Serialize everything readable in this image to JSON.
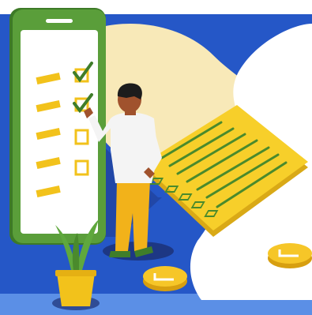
{
  "illustration": {
    "subject": "",
    "colors": {
      "background_blue": "#2557c7",
      "background_blue_light": "#3b7be0",
      "cream_blob": "#f8e9b8",
      "white_blob": "#ffffff",
      "phone_frame": "#5a9e3a",
      "phone_frame_dark": "#3d7a27",
      "phone_screen": "#ffffff",
      "checklist_yellow": "#f2c21b",
      "checkmark_green": "#3f7d2a",
      "board_yellow": "#f7cf2a",
      "board_yellow_dark": "#d9a916",
      "board_line_green": "#4a8a2c",
      "coin_yellow": "#f6c628",
      "coin_dark": "#d79f10",
      "person_shirt": "#f4f4f4",
      "person_pants": "#f2b21a",
      "person_skin": "#a0522d",
      "person_hair": "#1c1c1c",
      "plant_leaf": "#5fa83d",
      "plant_pot": "#f2c21b",
      "shadow": "#1f3b8c",
      "ground": "#5b8fe6"
    },
    "checklist": {
      "rows": 5,
      "checked": [
        true,
        true,
        false,
        false,
        false
      ]
    },
    "coins": 2
  }
}
